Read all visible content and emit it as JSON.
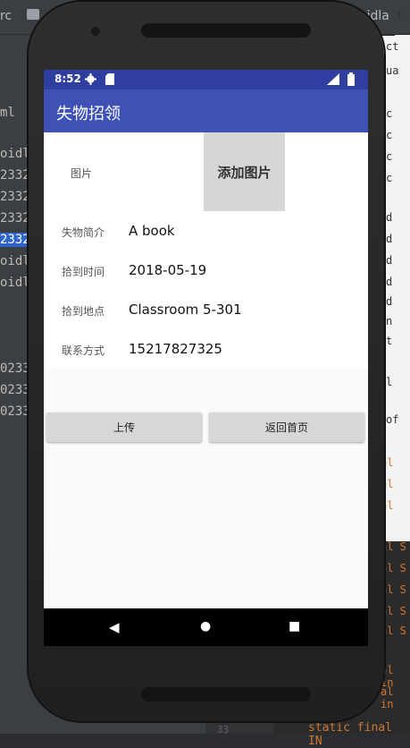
{
  "ide": {
    "top_left": "rc",
    "top_right": "oidla",
    "top_right_char": "t",
    "tree": [
      {
        "text": "ml",
        "selected": false
      },
      {
        "text": "oidlal",
        "selected": false
      },
      {
        "text": "2332",
        "selected": false
      },
      {
        "text": "2332",
        "selected": false
      },
      {
        "text": "2332",
        "selected": false
      },
      {
        "text": "2332",
        "selected": true
      },
      {
        "text": "oidlal",
        "selected": false
      },
      {
        "text": "oidlal",
        "selected": false
      },
      {
        "text": "0233",
        "selected": false
      },
      {
        "text": "0233",
        "selected": false
      },
      {
        "text": "0233",
        "selected": false
      }
    ],
    "code_right": [
      "ct",
      "ua",
      "c",
      "c",
      "c",
      "c",
      "d",
      "d",
      "d",
      "d",
      "d",
      "n",
      "t",
      "l",
      "of"
    ],
    "code_kw": [
      "al",
      "al",
      "al",
      "al S",
      "al S",
      "al S",
      "al S",
      "al S",
      "al in",
      "al in"
    ],
    "gutter_number": "33",
    "bottom_code": "static final IN"
  },
  "status": {
    "time": "8:52",
    "icons": [
      "gear-icon",
      "sd-card-icon",
      "signal-icon",
      "battery-icon"
    ]
  },
  "app": {
    "title": "失物招领"
  },
  "form": {
    "image_label": "图片",
    "add_image_button": "添加图片",
    "fields": [
      {
        "label": "失物简介",
        "value": "A book"
      },
      {
        "label": "拾到时间",
        "value": "2018-05-19"
      },
      {
        "label": "拾到地点",
        "value": "Classroom 5-301"
      },
      {
        "label": "联系方式",
        "value": "15217827325"
      }
    ]
  },
  "actions": {
    "upload": "上传",
    "back_home": "返回首页"
  },
  "navigation": {
    "back": "◀",
    "home": "●",
    "recents": "■"
  }
}
